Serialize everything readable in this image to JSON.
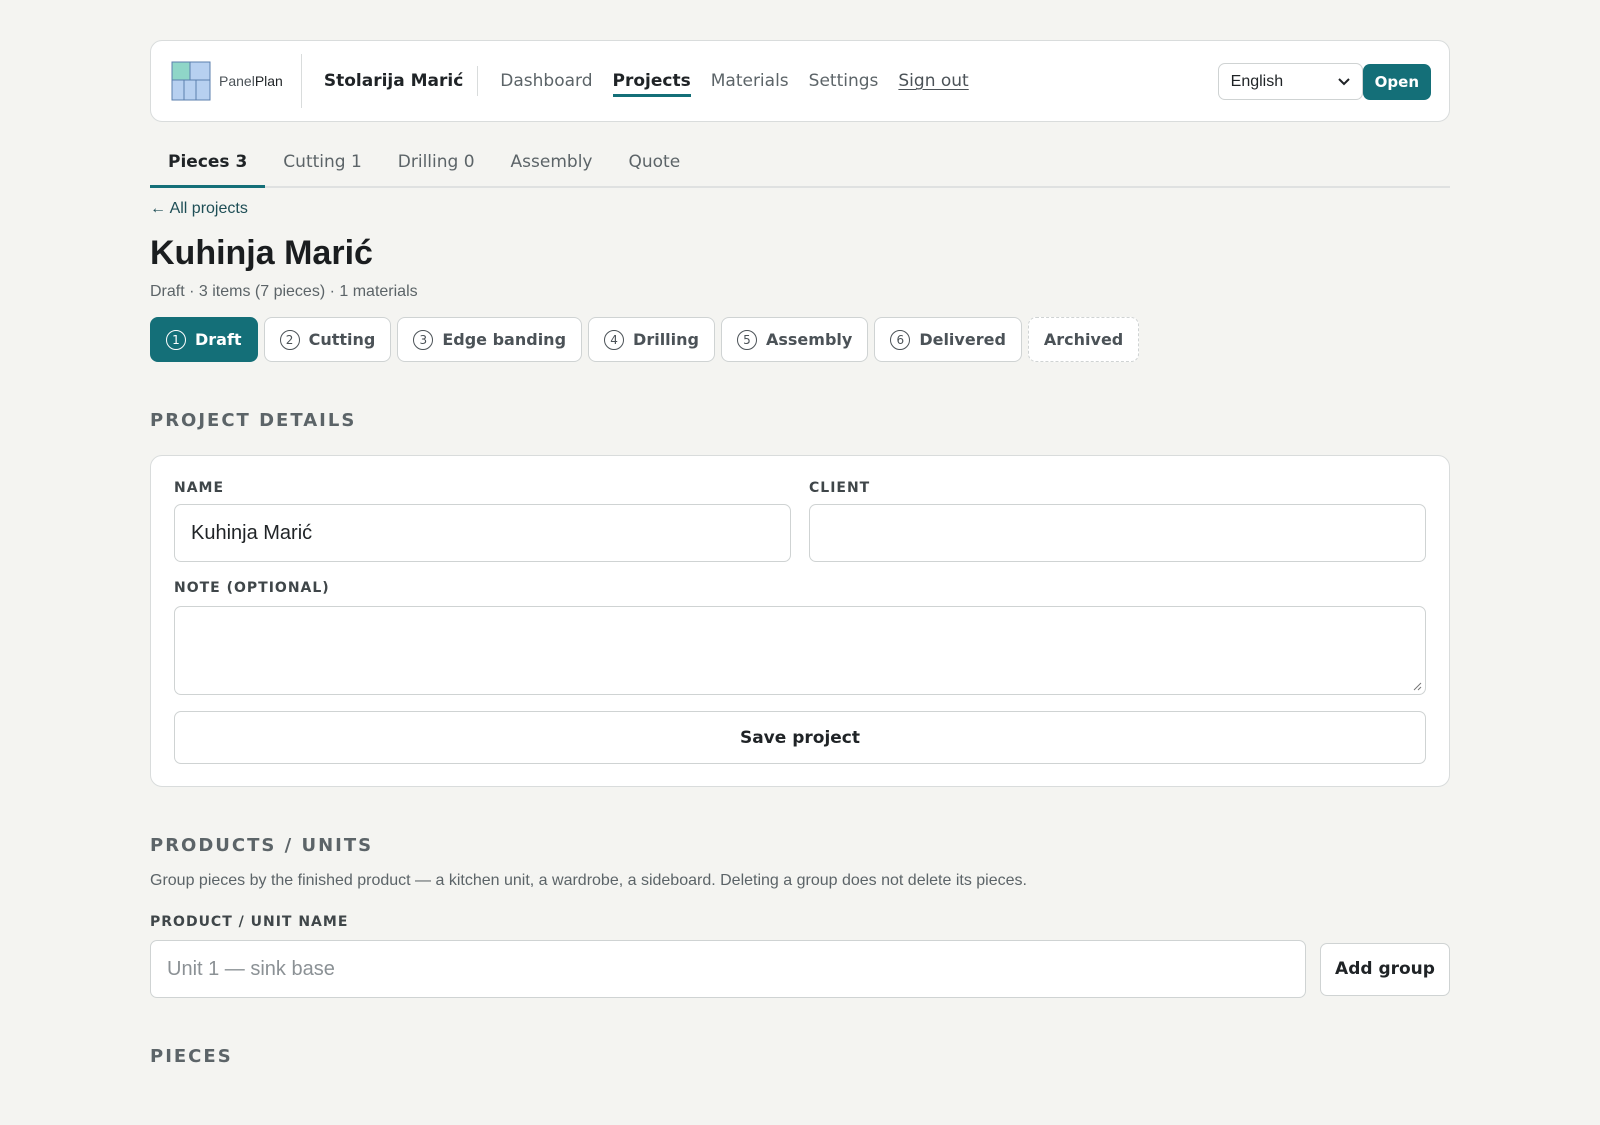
{
  "brand": {
    "logo_prefix": "Panel",
    "logo_suffix": "Plan",
    "org_name": "Stolarija Marić"
  },
  "nav": {
    "dashboard": "Dashboard",
    "projects": "Projects",
    "materials": "Materials",
    "settings": "Settings",
    "sign_out": "Sign out"
  },
  "toolbar": {
    "language_value": "English",
    "open_label": "Open"
  },
  "tabs": [
    {
      "label": "Pieces 3",
      "active": true
    },
    {
      "label": "Cutting 1"
    },
    {
      "label": "Drilling 0"
    },
    {
      "label": "Assembly"
    },
    {
      "label": "Quote"
    }
  ],
  "back_link": "← All projects",
  "project": {
    "title": "Kuhinja Marić",
    "meta": "Draft · 3 items (7 pieces) · 1 materials"
  },
  "stages": [
    {
      "num": "1",
      "label": "Draft"
    },
    {
      "num": "2",
      "label": "Cutting"
    },
    {
      "num": "3",
      "label": "Edge banding"
    },
    {
      "num": "4",
      "label": "Drilling"
    },
    {
      "num": "5",
      "label": "Assembly"
    },
    {
      "num": "6",
      "label": "Delivered"
    },
    {
      "label": "Archived"
    }
  ],
  "details": {
    "heading": "PROJECT DETAILS",
    "name_label": "NAME",
    "name_value": "Kuhinja Marić",
    "client_label": "CLIENT",
    "client_value": "",
    "note_label": "NOTE (OPTIONAL)",
    "note_value": "",
    "save_label": "Save project"
  },
  "products": {
    "heading": "PRODUCTS / UNITS",
    "help": "Group pieces by the finished product — a kitchen unit, a wardrobe, a sideboard. Deleting a group does not delete its pieces.",
    "unit_label": "PRODUCT / UNIT NAME",
    "unit_placeholder": "Unit 1 — sink base",
    "add_label": "Add group"
  },
  "pieces": {
    "heading": "PIECES"
  },
  "colors": {
    "accent": "#146f78",
    "background": "#f4f4f1"
  }
}
